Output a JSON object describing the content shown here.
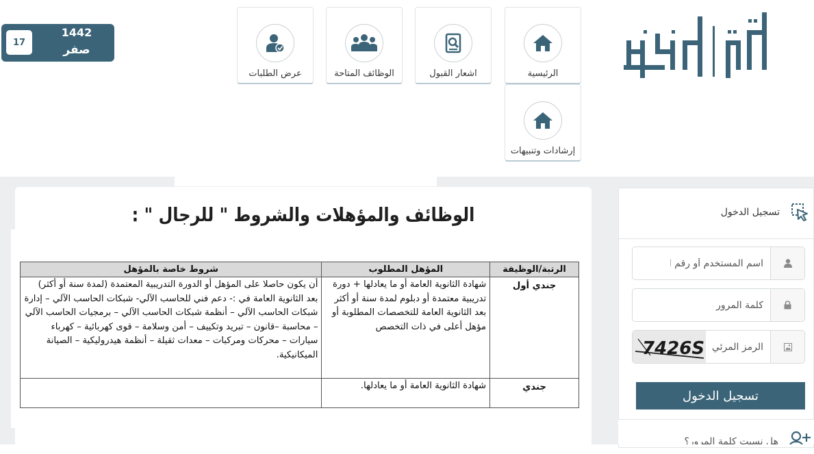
{
  "header": {
    "logo_text": "أبشر توظيف",
    "nav": [
      {
        "id": "home",
        "label": "الرئيسية",
        "icon": "home-icon"
      },
      {
        "id": "acceptance",
        "label": "اشعار القبول",
        "icon": "acceptance-notice-icon"
      },
      {
        "id": "available-jobs",
        "label": "الوظائف المتاحة",
        "icon": "group-users-icon"
      },
      {
        "id": "view-requests",
        "label": "عرض الطلبات",
        "icon": "user-check-icon"
      },
      {
        "id": "guidance",
        "label": "إرشادات وتنبيهات",
        "icon": "home-icon"
      }
    ],
    "hijri_date": {
      "day": "17",
      "month": "صفر",
      "year": "1442"
    }
  },
  "main": {
    "title": "الوظائف والمؤهلات والشروط \" للرجال \" :",
    "table": {
      "headers": [
        "الرتبة/الوظيفة",
        "المؤهل المطلوب",
        "شروط خاصة بالمؤهل"
      ],
      "rows": [
        {
          "rank": "جندي أول",
          "qualification": "شهادة الثانوية العامة أو ما يعادلها + دورة تدريبية معتمدة أو دبلوم لمدة سنة أو أكثر بعد الثانوية العامة للتخصصات المطلوبة أو مؤهل أعلى في ذات التخصص",
          "conditions": "أن يكون حاصلا على المؤهل أو الدورة التدريبية المعتمدة (لمدة سنة أو أكثر) بعد الثانوية العامة في :- دعم فني للحاسب الآلي- شبكات الحاسب الآلي – إدارة شبكات الحاسب الآلي – أنظمة شبكات الحاسب الآلي – برمجيات الحاسب الآلي – محاسبة –قانون – تبريد وتكييف – أمن وسلامة – قوى كهربائية – كهرباء سيارات – محركات ومركبات – معدات ثقيلة – أنظمة هيدروليكية – الصيانة الميكانيكية."
        },
        {
          "rank": "جندي",
          "qualification": "شهادة الثانوية العامة أو ما يعادلها.",
          "conditions": ""
        }
      ]
    }
  },
  "login": {
    "title": "تسجيل الدخول",
    "username_placeholder": "اسم المستخدم أو رقم الهوية",
    "password_placeholder": "كلمة المرور",
    "captcha_placeholder": "الرمز المرئي",
    "captcha_text": "7426S",
    "submit_label": "تسجيل الدخول",
    "forgot_label": "هل نسيت كلمة المرور؟"
  },
  "colors": {
    "primary": "#3b6478",
    "background": "#eceeef",
    "tile_border": "#b8cbd3"
  }
}
